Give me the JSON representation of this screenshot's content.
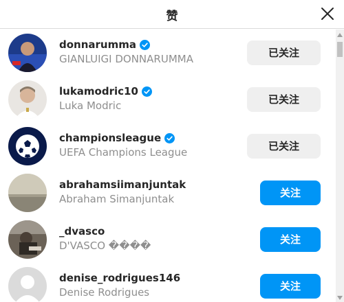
{
  "header": {
    "title": "赞"
  },
  "buttons": {
    "following": "已关注",
    "follow": "关注"
  },
  "users": [
    {
      "username": "donnarumma",
      "full_name": "GIANLUIGI DONNARUMMA",
      "verified": true,
      "status": "following"
    },
    {
      "username": "lukamodric10",
      "full_name": "Luka Modric",
      "verified": true,
      "status": "following"
    },
    {
      "username": "championsleague",
      "full_name": "UEFA Champions League",
      "verified": true,
      "status": "following"
    },
    {
      "username": "abrahamsiimanjuntak",
      "full_name": "Abraham Simanjuntak",
      "verified": false,
      "status": "follow"
    },
    {
      "username": "_dvasco",
      "full_name": "D'VASCO ����",
      "verified": false,
      "status": "follow"
    },
    {
      "username": "denise_rodrigues146",
      "full_name": "Denise Rodrigues",
      "verified": false,
      "status": "follow"
    }
  ],
  "colors": {
    "accent": "#0095f6",
    "verified": "#0095f6",
    "secondary_text": "#8e8e8e"
  }
}
